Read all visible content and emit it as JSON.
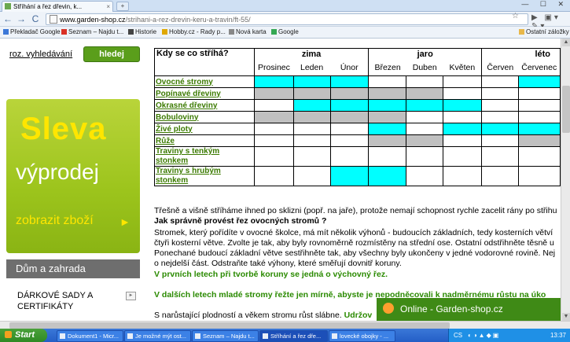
{
  "browser": {
    "tab_title": "Stříhání a řez dřevin, k...",
    "tab_close": "×",
    "new_tab": "+",
    "window_controls": "— ☐ ✕",
    "nav_back": "←",
    "nav_forward": "→",
    "nav_reload": "C",
    "url_host": "www.garden-shop.cz",
    "url_path": "/strihani-a-rez-drevin-keru-a-travin/ft-55/",
    "star": "☆",
    "right_buttons": "▶ ▣▾ ✎▾"
  },
  "bookmarks": [
    {
      "label": "Překladač Google",
      "color": "#3c78d8"
    },
    {
      "label": "Seznam – Najdu t...",
      "color": "#d93025"
    },
    {
      "label": "Historie",
      "color": "#444444"
    },
    {
      "label": "Hobby.cz - Rady p...",
      "color": "#e0a800"
    },
    {
      "label": "Nová karta",
      "color": "#888888"
    },
    {
      "label": "Google",
      "color": "#34a853"
    }
  ],
  "bookmarks_other": "Ostatní záložky",
  "sidebar": {
    "search_link": "roz. vyhledávání",
    "search_button": "hledej",
    "promo_line1": "Sleva",
    "promo_line2": "výprodej",
    "promo_line3": "zobrazit zboží",
    "promo_arrow": "►",
    "category_home": "Dům a zahrada",
    "category_sets": "DÁRKOVÉ SADY A CERTIFIKÁTY",
    "category_sets_arrow": "►"
  },
  "table": {
    "header": "Kdy se co stříhá?",
    "seasons": [
      "zima",
      "jaro",
      "léto"
    ],
    "months": [
      "Prosinec",
      "Leden",
      "Únor",
      "Březen",
      "Duben",
      "Květen",
      "Červen",
      "Červenec"
    ],
    "rows": [
      {
        "name": "Ovocné stromy",
        "cells": [
          "c",
          "c",
          "c",
          "n",
          "n",
          "n",
          "n",
          "c"
        ]
      },
      {
        "name": "Popínavé dřeviny",
        "cells": [
          "g",
          "g",
          "g",
          "g",
          "g",
          "n",
          "n",
          "n"
        ]
      },
      {
        "name": "Okrasné dřeviny",
        "cells": [
          "n",
          "c",
          "c",
          "c",
          "c",
          "c",
          "n",
          "n"
        ]
      },
      {
        "name": "Bobuloviny",
        "cells": [
          "g",
          "g",
          "g",
          "g",
          "n",
          "n",
          "n",
          "n"
        ]
      },
      {
        "name": "Živé ploty",
        "cells": [
          "n",
          "n",
          "n",
          "c",
          "n",
          "c",
          "c",
          "c"
        ]
      },
      {
        "name": "Růže",
        "cells": [
          "n",
          "n",
          "n",
          "g",
          "g",
          "n",
          "n",
          "g"
        ]
      },
      {
        "name": "Traviny s tenkým stonkem",
        "cells": [
          "n",
          "n",
          "n",
          "n",
          "n",
          "n",
          "n",
          "n"
        ]
      },
      {
        "name": "Traviny s hrubým stonkem",
        "cells": [
          "n",
          "n",
          "c",
          "c",
          "n",
          "n",
          "n",
          "n"
        ]
      }
    ]
  },
  "article": {
    "p1": "Třešně a višně stříháme ihned po sklizni (popř. na jaře), protože nemají schopnost rychle zacelit rány po střihu",
    "q1": "Jak správně provést řez ovocných stromů ?",
    "p2": "Stromek, který pořídíte v ovocné školce, má mít několik výhonů - budoucích základních, tedy kosterních větví",
    "p3": "čtyři kosterní větve. Zvolte je tak, aby byly rovnoměrně rozmístěny na střední ose. Ostatní odstřihněte těsně u",
    "p4": "Ponechané budoucí základní větve sestřihněte tak, aby všechny byly ukončeny v jedné vodorovné rovině. Nej",
    "p5": "o nejdelší část. Odstraňte také výhony, které směřují dovnitř koruny.",
    "g1": "V prvních letech při tvorbě koruny se jedná o výchovný řez.",
    "g2": "V dalších letech mladé stromy řežte jen mírně, abyste je nepodněcovali k nadměrnému růstu na úko",
    "p6": "S narůstající plodností a věkem stromu růst slábne.",
    "p6b": "Udržov"
  },
  "chat": {
    "label": "Online - Garden-shop.cz"
  },
  "taskbar": {
    "start": "Start",
    "tasks": [
      "Dokument1 - Micr...",
      "Je možné mýt ost...",
      "Seznam – Najdu t...",
      "Stříhání a řez dře...",
      "lovecké obojky - ..."
    ],
    "lang": "CS",
    "tray_icons": "◐◑▲◆▣",
    "clock": "13:37"
  }
}
